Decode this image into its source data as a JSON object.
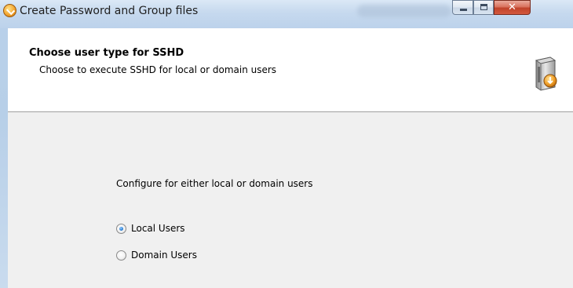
{
  "window": {
    "title": "Create Password and Group files"
  },
  "header": {
    "title": "Choose user type for SSHD",
    "subtitle": "Choose to execute SSHD for local or domain users"
  },
  "body": {
    "prompt": "Configure for either local or domain users",
    "options": [
      {
        "label": "Local Users",
        "selected": true
      },
      {
        "label": "Domain Users",
        "selected": false
      }
    ]
  },
  "colors": {
    "titlebar": "#c6d9ee",
    "header_bg": "#ffffff",
    "body_bg": "#f0f0f0",
    "close_button": "#c0432a",
    "radio_dot": "#2a7fd4"
  },
  "icons": {
    "app": "installer-icon",
    "header": "setup-package-icon"
  }
}
